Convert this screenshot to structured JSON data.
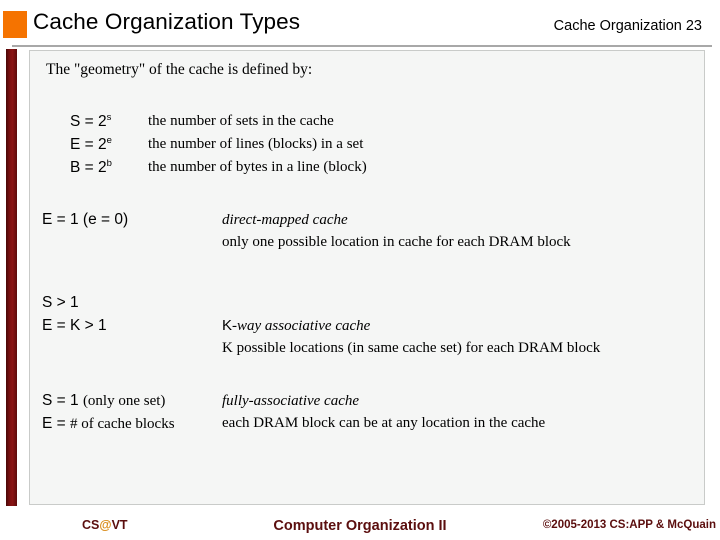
{
  "header": {
    "title": "Cache Organization Types",
    "right_label": "Cache Organization 23",
    "accent_orange": "#F57300",
    "rule_color": "#A8A8A8"
  },
  "left_bar": {
    "color": "#7d1010"
  },
  "content": {
    "intro": "The \"geometry\" of the cache is defined by:",
    "definitions": [
      {
        "base": "S = 2",
        "exp": "s",
        "description": "the number of sets in the cache"
      },
      {
        "base": "E = 2",
        "exp": "e",
        "description": "the number of lines (blocks) in a set"
      },
      {
        "base": "B = 2",
        "exp": "b",
        "description": "the number of bytes in a line (block)"
      }
    ],
    "cases": [
      {
        "cond_line1": "E = 1 (e = 0)",
        "cond_line2": "",
        "name_upright": "",
        "name_italic": "direct-mapped cache",
        "detail": "only one possible location in cache for each DRAM block"
      },
      {
        "cond_line1": "S > 1",
        "cond_line2": "E = K > 1",
        "name_upright": "K",
        "name_italic": "-way associative cache",
        "detail": "K possible locations (in same cache set) for each DRAM block"
      },
      {
        "cond_line1_sans": "S = 1 ",
        "cond_line1_serif": "(only one set)",
        "cond_line2_sans": "E = ",
        "cond_line2_serif": "# of cache blocks",
        "name_upright": "",
        "name_italic": "fully-associative cache",
        "detail": "each DRAM block can be at any location in the cache"
      }
    ]
  },
  "footer": {
    "left_prefix": "CS",
    "left_at": "@",
    "left_suffix": "VT",
    "center": "Computer Organization II",
    "right": "©2005-2013 CS:APP & McQuain",
    "color": "#5B0E0E",
    "at_color": "#D98A18"
  }
}
